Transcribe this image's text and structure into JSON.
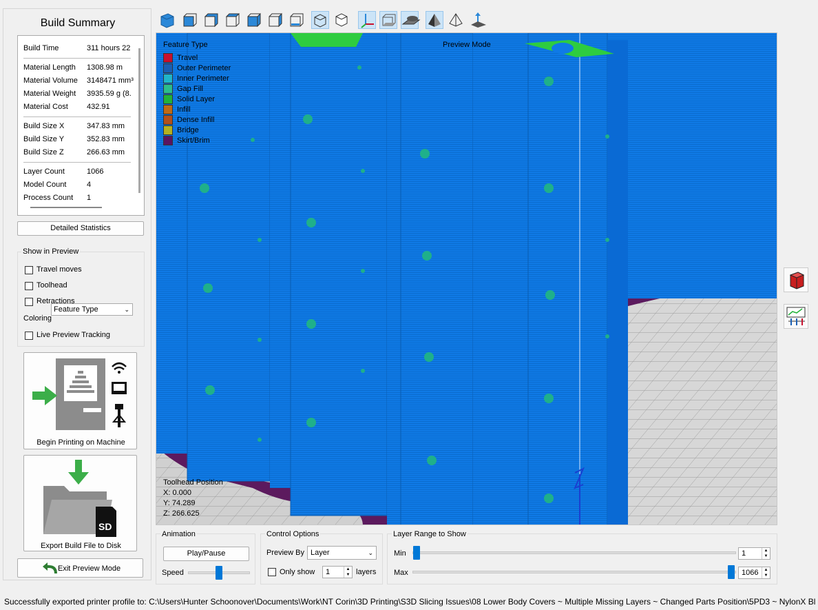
{
  "summary": {
    "title": "Build Summary",
    "rows": [
      {
        "k": "Build Time",
        "v": "311 hours 22"
      },
      {
        "k": "Material Length",
        "v": "1308.98 m"
      },
      {
        "k": "Material Volume",
        "v": "3148471 mm³"
      },
      {
        "k": "Material Weight",
        "v": "3935.59 g (8."
      },
      {
        "k": "Material Cost",
        "v": "432.91"
      },
      {
        "k": "Build Size X",
        "v": "347.83 mm"
      },
      {
        "k": "Build Size Y",
        "v": "352.83 mm"
      },
      {
        "k": "Build Size Z",
        "v": "266.63 mm"
      },
      {
        "k": "Layer Count",
        "v": "1066"
      },
      {
        "k": "Model Count",
        "v": "4"
      },
      {
        "k": "Process Count",
        "v": "1"
      }
    ],
    "detailed_btn": "Detailed Statistics"
  },
  "preview": {
    "group_label": "Show in Preview",
    "travel": "Travel moves",
    "toolhead": "Toolhead",
    "retractions": "Retractions",
    "coloring_label": "Coloring",
    "coloring_value": "Feature Type",
    "live": "Live Preview Tracking"
  },
  "actions": {
    "print": "Begin Printing on Machine",
    "export": "Export Build File to Disk",
    "sd": "SD",
    "exit": "Exit Preview Mode"
  },
  "viewport": {
    "legend_title": "Feature Type",
    "mode_label": "Preview Mode",
    "legend": [
      {
        "name": "Travel",
        "color": "#c8102e"
      },
      {
        "name": "Outer Perimeter",
        "color": "#1a5fb4"
      },
      {
        "name": "Inner Perimeter",
        "color": "#1fb5c9"
      },
      {
        "name": "Gap Fill",
        "color": "#2bbd8c"
      },
      {
        "name": "Solid Layer",
        "color": "#21b23a"
      },
      {
        "name": "Infill",
        "color": "#c06a14"
      },
      {
        "name": "Dense Infill",
        "color": "#b3501a"
      },
      {
        "name": "Bridge",
        "color": "#b5b020"
      },
      {
        "name": "Skirt/Brim",
        "color": "#5a1460"
      }
    ],
    "toolhead_title": "Toolhead Position",
    "x": "X: 0.000",
    "y": "Y: 74.289",
    "z": "Z: 266.625"
  },
  "animation": {
    "label": "Animation",
    "play": "Play/Pause",
    "speed": "Speed"
  },
  "control": {
    "label": "Control Options",
    "preview_by": "Preview By",
    "preview_by_value": "Layer",
    "only_show": "Only show",
    "only_show_value": "1",
    "layers": "layers"
  },
  "range": {
    "label": "Layer Range to Show",
    "min": "Min",
    "max": "Max",
    "min_value": "1",
    "max_value": "1066",
    "min_fraction": 0.0,
    "max_fraction": 1.0
  },
  "status": "Successfully exported printer profile to: C:\\Users\\Hunter Schoonover\\Documents\\Work\\NT Corin\\3D Printing\\S3D Slicing Issues\\08 Lower Body Covers ~ Multiple Missing Layers ~ Changed Parts Position\\5PD3 ~ NylonX Bl"
}
